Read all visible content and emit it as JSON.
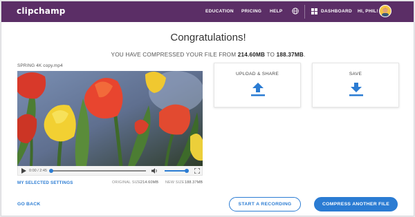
{
  "nav": {
    "logo": "clipchamp",
    "education": "EDUCATION",
    "pricing": "PRICING",
    "help": "HELP",
    "dashboard": "DASHBOARD",
    "greeting": "HI, PHIL!",
    "bar_color": "#5b2e66"
  },
  "heading": {
    "title": "Congratulations!",
    "subtitle_prefix": "YOU HAVE COMPRESSED YOUR FILE FROM",
    "from_size": "214.60MB",
    "subtitle_to": "TO",
    "to_size": "188.37MB",
    "subtitle_end": "."
  },
  "video": {
    "filename": "SPRING 4K copy.mp4",
    "time": "0:00 / 2:45",
    "progress": 0,
    "volume": 1
  },
  "settings": {
    "link": "MY SELECTED SETTINGS",
    "original_label": "ORIGINAL SIZE",
    "original_value": "214.60MB",
    "new_label": "NEW SIZE",
    "new_value": "188.37MB"
  },
  "cards": {
    "upload_label": "UPLOAD & SHARE",
    "upload_icon": "upload-arrow-icon",
    "save_label": "SAVE",
    "save_icon": "download-arrow-icon"
  },
  "footer": {
    "go_back": "GO BACK",
    "record": "START A RECORDING",
    "compress": "COMPRESS ANOTHER FILE",
    "accent": "#2b7cd3"
  }
}
